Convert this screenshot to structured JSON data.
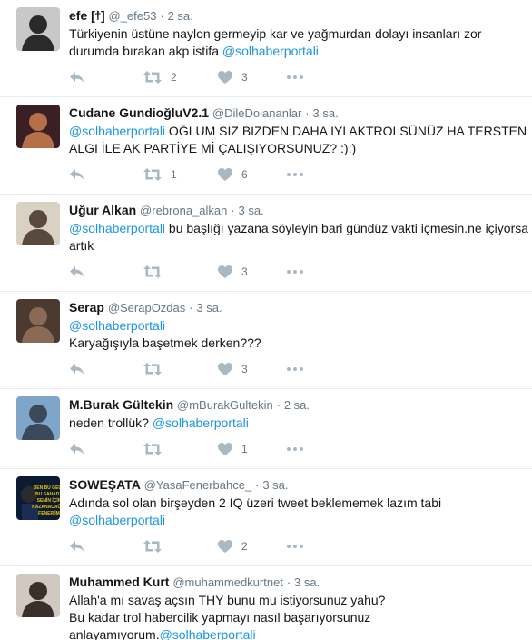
{
  "tweets": [
    {
      "name": "efe [ϯ]",
      "handle": "@_efe53",
      "time": "2 sa.",
      "text_pre": "Türkiyenin üstüne naylon germeyip kar ve yağmurdan dolayı insanları zor durumda bırakan akp istifa ",
      "mention": "@solhaberportali",
      "text_post": "",
      "retweets": "2",
      "likes": "3",
      "avatar_bg": "#c8c8c8",
      "avatar_fg": "#2a2a2a"
    },
    {
      "name": "Cudane GundioğluV2.1",
      "handle": "@DileDolananlar",
      "time": "3 sa.",
      "text_pre": "",
      "mention": "@solhaberportali",
      "text_post": " OĞLUM SİZ BİZDEN DAHA İYİ AKTROLSÜNÜZ HA TERSTEN ALGI İLE AK PARTİYE Mİ ÇALIŞIYORSUNUZ? :):)",
      "retweets": "1",
      "likes": "6",
      "avatar_bg": "#3a1f25",
      "avatar_fg": "#b5704a"
    },
    {
      "name": "Uğur Alkan",
      "handle": "@rebrona_alkan",
      "time": "3 sa.",
      "text_pre": "",
      "mention": "@solhaberportali",
      "text_post": " bu başlığı yazana söyleyin bari gündüz vakti içmesin.ne içiyorsa artık",
      "retweets": "",
      "likes": "3",
      "avatar_bg": "#d9d2c4",
      "avatar_fg": "#5a4a3e"
    },
    {
      "name": "Serap",
      "handle": "@SerapOzdas",
      "time": "3 sa.",
      "text_pre": "",
      "mention": "@solhaberportali",
      "text_post": "\nKaryağışıyla başetmek derken???",
      "retweets": "",
      "likes": "3",
      "avatar_bg": "#4a3a30",
      "avatar_fg": "#8a6a55"
    },
    {
      "name": "M.Burak Gültekin",
      "handle": "@mBurakGultekin",
      "time": "2 sa.",
      "text_pre": "neden trollük? ",
      "mention": "@solhaberportali",
      "text_post": "",
      "retweets": "",
      "likes": "1",
      "avatar_bg": "#7fa6c9",
      "avatar_fg": "#3b4a5a"
    },
    {
      "name": "SOWEŞATA",
      "handle": "@YasaFenerbahce_",
      "time": "3 sa.",
      "text_pre": "Adında sol olan birşeyden 2 IQ üzeri tweet beklememek lazım tabi\n",
      "mention": "@solhaberportali",
      "text_post": "",
      "retweets": "",
      "likes": "2",
      "avatar_bg": "#0d1a33",
      "avatar_fg": "#e8c400",
      "avatar_text": "BEN BU GEÇE\nBU SAHADA\nSENİN İÇİN\nKAZANACAĞIM\nBENİM\nFENER'İM"
    },
    {
      "name": "Muhammed Kurt",
      "handle": "@muhammedkurtnet",
      "time": "3 sa.",
      "text_pre": "Allah'a mı savaş açsın THY bunu mu istiyorsunuz yahu?\nBu kadar trol habercilik yapmayı nasıl başarıyorsunuz\nanlayamıyorum.",
      "mention": "@solhaberportali",
      "text_post": "",
      "retweets": "",
      "likes": "",
      "avatar_bg": "#cfc9c2",
      "avatar_fg": "#3a2f2a"
    }
  ],
  "icons": {
    "reply": "reply-icon",
    "retweet": "retweet-icon",
    "like": "heart-icon",
    "more": "more-icon"
  },
  "colors": {
    "link": "#1b95e0",
    "muted": "#657786",
    "icon": "#aab8c2",
    "divider": "#e6ecf0"
  }
}
